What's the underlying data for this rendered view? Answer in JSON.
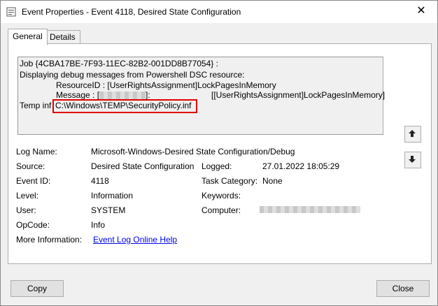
{
  "window": {
    "title": "Event Properties - Event 4118, Desired State Configuration",
    "close_glyph": "✕"
  },
  "tabs": [
    {
      "label": "General"
    },
    {
      "label": "Details"
    }
  ],
  "message": {
    "line1": "Job {4CBA17BE-7F93-11EC-82B2-001DD8B77054} :",
    "line2": "Displaying debug messages from Powershell DSC resource:",
    "line3": "ResourceID : [UserRightsAssignment]LockPagesInMemory",
    "line4_prefix": "Message : [",
    "line4_suffix": "]:",
    "line4_right": "[[UserRightsAssignment]LockPagesInMemory]",
    "line5_prefix": "Temp inf",
    "line5_highlight": "C:\\Windows\\TEMP\\SecurityPolicy.inf"
  },
  "details": {
    "log_name_label": "Log Name:",
    "log_name_value": "Microsoft-Windows-Desired State Configuration/Debug",
    "source_label": "Source:",
    "source_value": "Desired State Configuration",
    "logged_label": "Logged:",
    "logged_value": "27.01.2022 18:05:29",
    "event_id_label": "Event ID:",
    "event_id_value": "4118",
    "task_category_label": "Task Category:",
    "task_category_value": "None",
    "level_label": "Level:",
    "level_value": "Information",
    "keywords_label": "Keywords:",
    "user_label": "User:",
    "user_value": "SYSTEM",
    "computer_label": "Computer:",
    "opcode_label": "OpCode:",
    "opcode_value": "Info",
    "more_info_label": "More Information:",
    "more_info_link": "Event Log Online Help"
  },
  "buttons": {
    "copy": "Copy",
    "close": "Close"
  },
  "icons": {
    "app": "event-viewer-icon",
    "up": "arrow-up-icon",
    "down": "arrow-down-icon"
  }
}
